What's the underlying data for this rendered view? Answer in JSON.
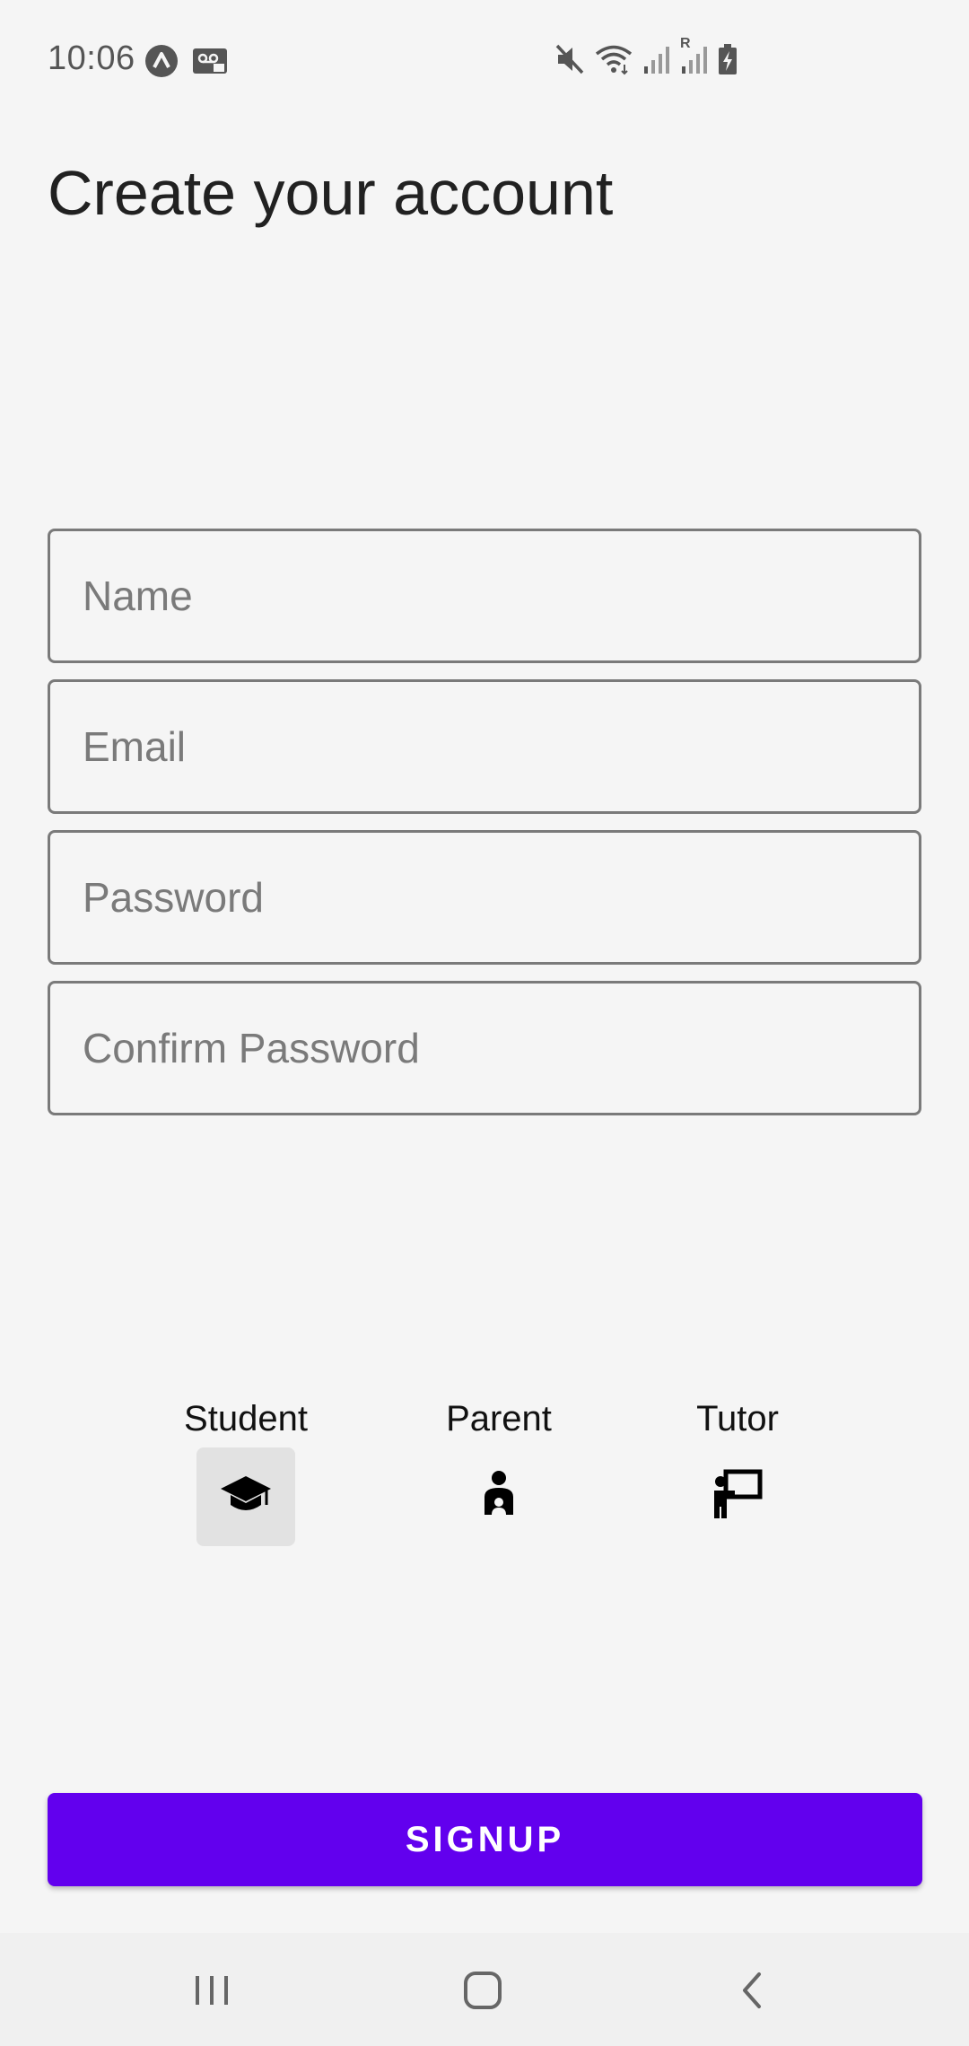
{
  "status_bar": {
    "time": "10:06",
    "left_icons": [
      "app-notification-icon",
      "voicemail-icon"
    ],
    "right_icons": [
      "mute-icon",
      "wifi-icon",
      "signal-icon",
      "roaming-signal-icon",
      "battery-charging-icon"
    ],
    "roaming_label": "R"
  },
  "page": {
    "title": "Create your account"
  },
  "form": {
    "name_placeholder": "Name",
    "email_placeholder": "Email",
    "password_placeholder": "Password",
    "confirm_password_placeholder": "Confirm Password"
  },
  "roles": {
    "selected": "Student",
    "student_label": "Student",
    "parent_label": "Parent",
    "tutor_label": "Tutor"
  },
  "signup": {
    "label": "SIGNUP",
    "color": "#6200ee"
  },
  "nav": {
    "icons": [
      "recents-icon",
      "home-icon",
      "back-icon"
    ]
  }
}
